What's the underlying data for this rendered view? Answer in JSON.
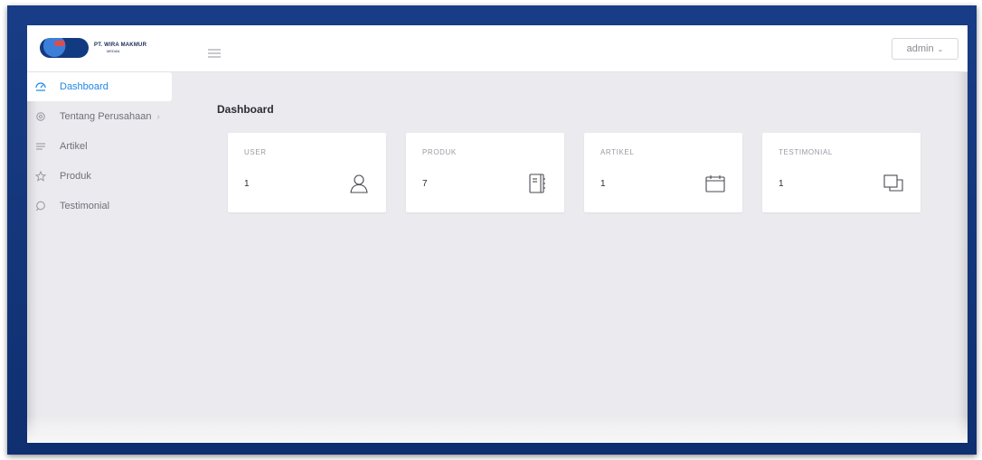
{
  "header": {
    "logo_name": "PT. WIRA MAKMUR",
    "logo_city": "MEDAN",
    "user_label": "admin",
    "user_caret": "⌄"
  },
  "sidebar": {
    "items": [
      {
        "label": "Dashboard",
        "icon": "dashboard-icon",
        "active": true
      },
      {
        "label": "Tentang Perusahaan",
        "icon": "settings-icon",
        "chevron": "›"
      },
      {
        "label": "Artikel",
        "icon": "list-icon"
      },
      {
        "label": "Produk",
        "icon": "star-icon"
      },
      {
        "label": "Testimonial",
        "icon": "chat-icon"
      }
    ]
  },
  "main": {
    "title": "Dashboard",
    "cards": [
      {
        "label": "USER",
        "value": "1",
        "icon": "user-icon"
      },
      {
        "label": "PRODUK",
        "value": "7",
        "icon": "notebook-icon"
      },
      {
        "label": "ARTIKEL",
        "value": "1",
        "icon": "calendar-icon"
      },
      {
        "label": "TESTIMONIAL",
        "value": "1",
        "icon": "copy-icon"
      }
    ]
  },
  "colors": {
    "frame": "#163a82",
    "accent": "#1e88e5",
    "background": "#ebebef"
  }
}
